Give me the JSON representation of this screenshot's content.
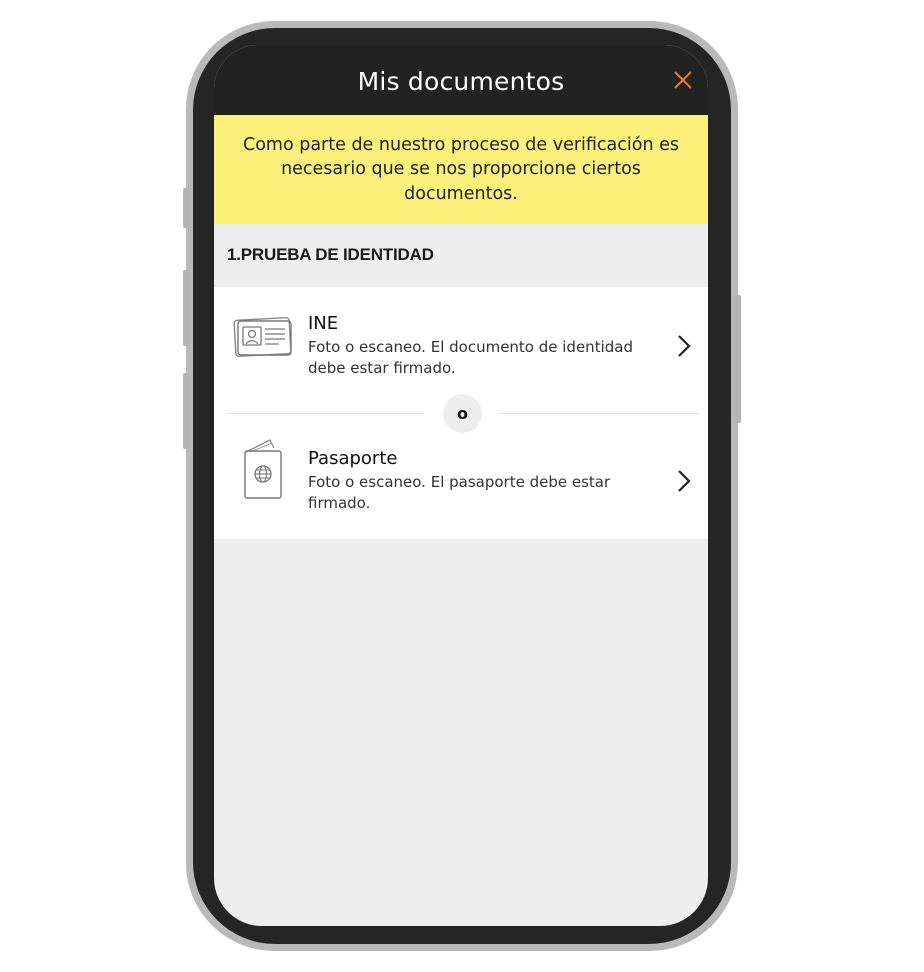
{
  "header": {
    "title": "Mis documentos",
    "close_icon": "close-icon",
    "close_color": "#e4773a"
  },
  "banner": {
    "text": "Como parte de nuestro proceso de verificación es necesario que se nos proporcione ciertos documentos.",
    "background": "#fbf17b"
  },
  "section": {
    "title": "1.PRUEBA DE IDENTIDAD"
  },
  "documents": [
    {
      "name": "INE",
      "description": "Foto o escaneo. El documento de identidad debe estar firmado.",
      "icon": "id-card-icon"
    },
    {
      "name": "Pasaporte",
      "description": "Foto o escaneo. El pasaporte debe estar firmado.",
      "icon": "passport-icon"
    }
  ],
  "separator": {
    "label": "o"
  }
}
